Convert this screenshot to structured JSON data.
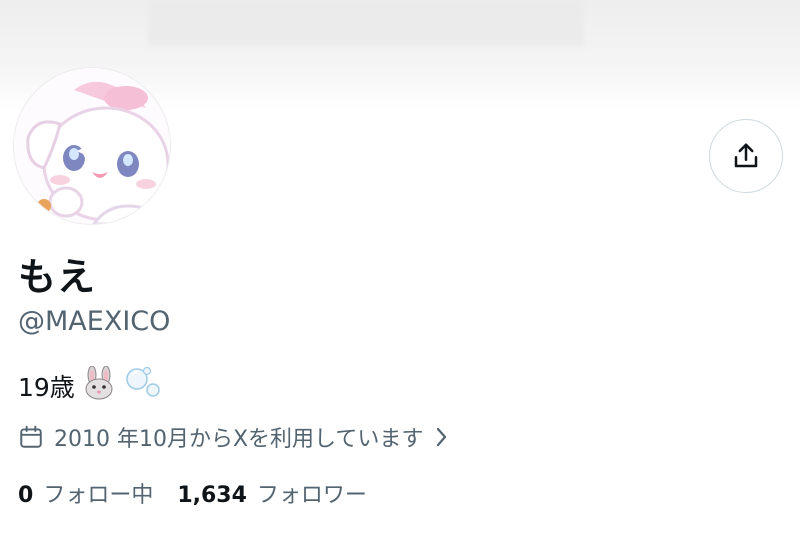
{
  "profile": {
    "display_name": "もえ",
    "handle": "@MAEXICO",
    "bio": "19歳",
    "bio_emojis": [
      "rabbit-face",
      "bubbles"
    ],
    "joined": "2010 年10月からXを利用しています",
    "following_count": "0",
    "following_label": "フォロー中",
    "followers_count": "1,634",
    "followers_label": "フォロワー"
  },
  "icons": {
    "share": "share-upload-icon",
    "calendar": "calendar-icon",
    "chevron": "chevron-right-icon"
  },
  "colors": {
    "primary_text": "#0f1419",
    "secondary_text": "#536471",
    "border": "#cfd9de"
  }
}
